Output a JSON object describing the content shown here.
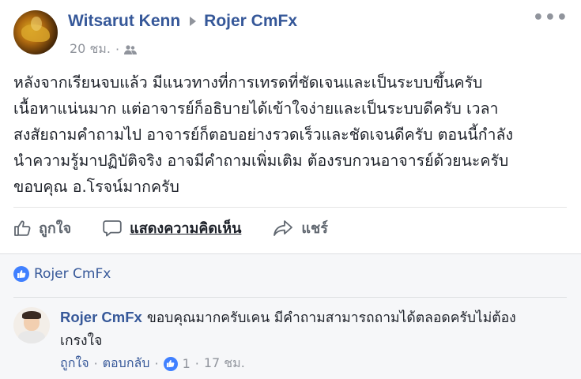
{
  "post": {
    "author": "Witsarut Kenn",
    "target": "Rojer CmFx",
    "time": "20 ชม.",
    "more": "•••",
    "lines": [
      "หลังจากเรียนจบแล้ว มีแนวทางที่การเทรดที่ชัดเจนและเป็นระบบขึ้นครับ",
      "เนื้อหาแน่นมาก แต่อาจารย์ก็อธิบายได้เข้าใจง่ายและเป็นระบบดีครับ เวลา",
      "สงสัยถามคำถามไป อาจารย์ก็ตอบอย่างรวดเร็วและชัดเจนดีครับ ตอนนี้กำลัง",
      "นำความรู้มาปฏิบัติจริง อาจมีคำถามเพิ่มเติม ต้องรบกวนอาจารย์ด้วยนะครับ",
      "ขอบคุณ อ.โรจน์มากครับ"
    ],
    "actions": {
      "like": "ถูกใจ",
      "comment": "แสดงความคิดเห็น",
      "share": "แชร์"
    }
  },
  "reactions": {
    "name": "Rojer CmFx"
  },
  "comment": {
    "author": "Rojer CmFx",
    "text": "ขอบคุณมากครับเคน มีคำถามสามารถถามได้ตลอดครับไม่ต้องเกรงใจ",
    "like": "ถูกใจ",
    "reply": "ตอบกลับ",
    "like_count": "1",
    "time": "17 ชม.",
    "dot": "·"
  }
}
